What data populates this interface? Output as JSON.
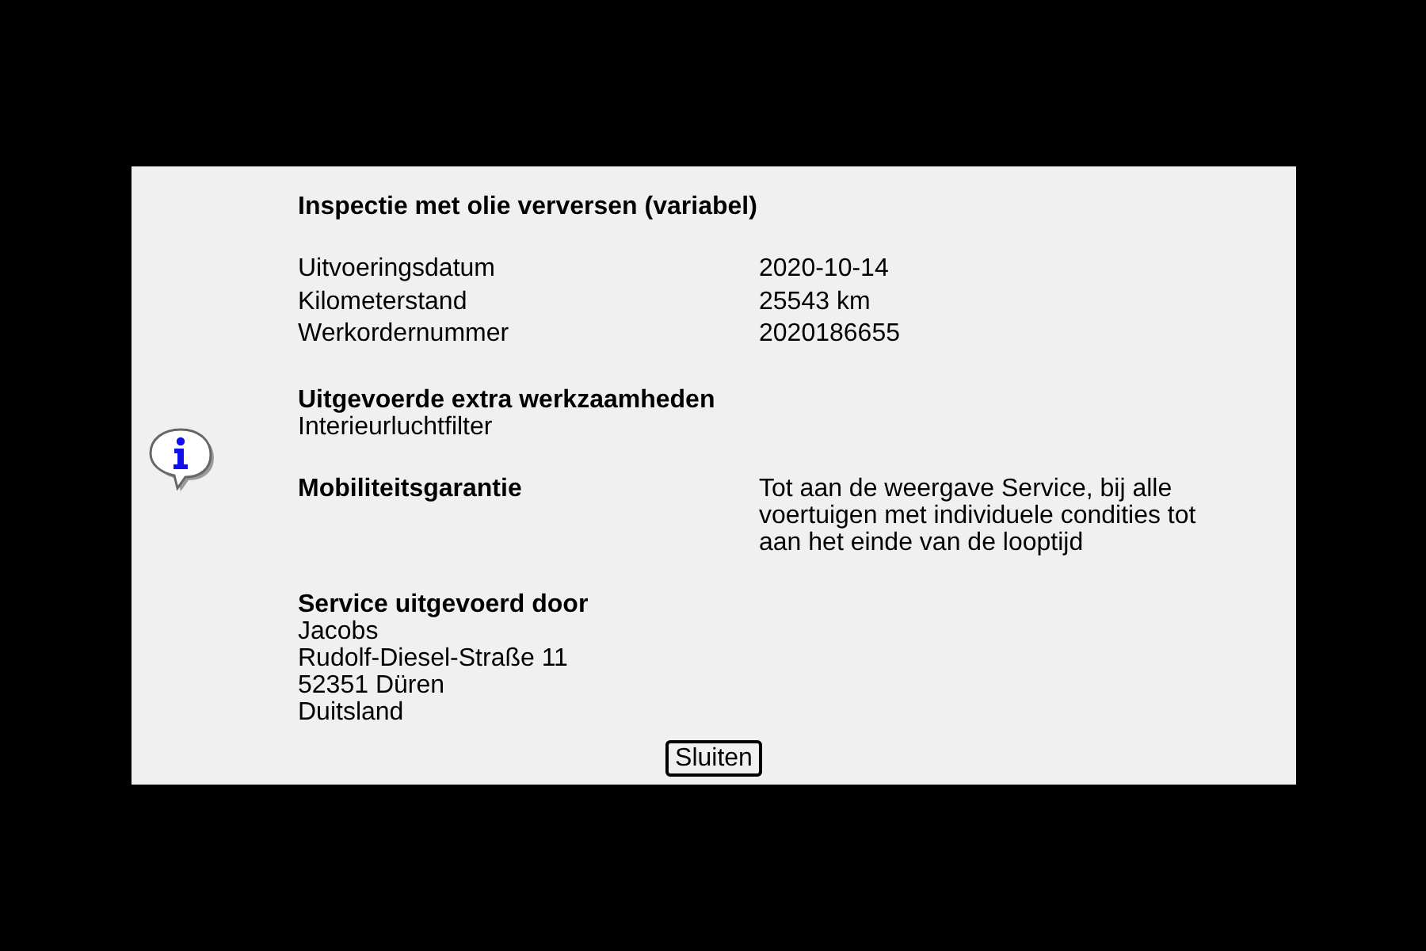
{
  "dialog": {
    "title": "Inspectie met olie verversen (variabel)",
    "details": [
      {
        "label": "Uitvoeringsdatum",
        "value": "2020-10-14"
      },
      {
        "label": "Kilometerstand",
        "value": "25543 km"
      },
      {
        "label": "Werkordernummer",
        "value": "2020186655"
      }
    ],
    "extra_work": {
      "heading": "Uitgevoerde extra werkzaamheden",
      "items": [
        "Interieurluchtfilter"
      ]
    },
    "guarantee": {
      "label": "Mobiliteitsgarantie",
      "text": "Tot aan de weergave Service, bij alle voertuigen met individuele condities tot aan het einde van de looptijd"
    },
    "service": {
      "heading": "Service uitgevoerd door",
      "lines": [
        "Jacobs",
        "Rudolf-Diesel-Straße 11",
        "52351 Düren",
        "Duitsland"
      ]
    },
    "close_button": "Sluiten"
  }
}
